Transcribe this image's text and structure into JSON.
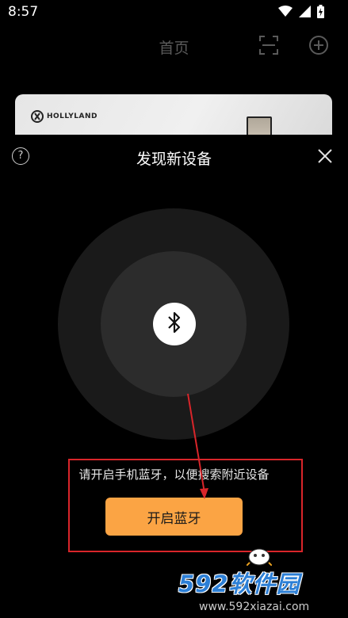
{
  "status_bar": {
    "time": "8:57",
    "icons": [
      "wifi-icon",
      "cellular-signal-icon",
      "battery-charging-icon"
    ]
  },
  "background_page": {
    "title": "首页",
    "header_icons": [
      "scan-icon",
      "add-circle-icon"
    ],
    "card": {
      "brand_logo_text": "HOLLYLAND"
    }
  },
  "sheet": {
    "title": "发现新设备",
    "help_icon_glyph": "?",
    "close_icon": "close-icon",
    "bluetooth_icon": "bluetooth-icon",
    "hint": "请开启手机蓝牙，以便搜索附近设备",
    "open_button_label": "开启蓝牙"
  },
  "colors": {
    "accent": "#fba444",
    "annotation": "#d9252a"
  },
  "watermark": {
    "main": "592软件园",
    "url": "www.592xiazai.com"
  }
}
